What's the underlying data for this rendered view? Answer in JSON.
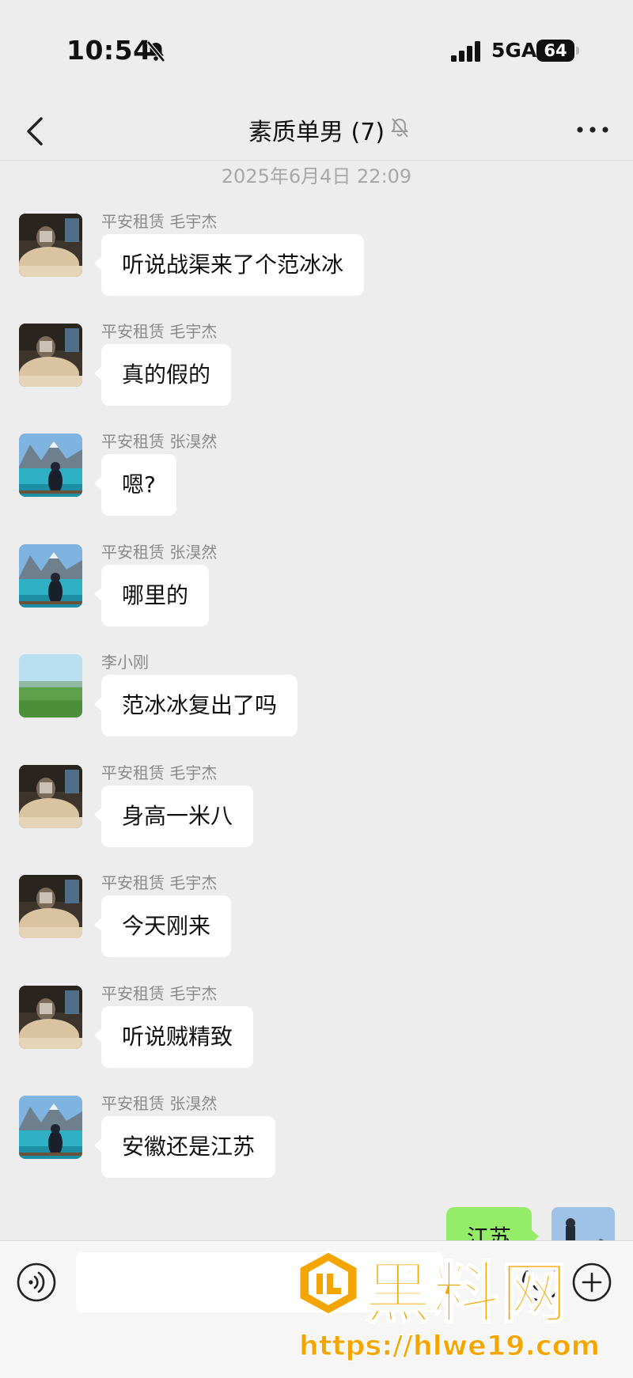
{
  "status_bar": {
    "time": "10:54",
    "network": "5GA",
    "battery": "64"
  },
  "header": {
    "title": "素质单男 (7)"
  },
  "chat": {
    "timestamp": "2025年6月4日 22:09",
    "messages": [
      {
        "sender": "平安租赁 毛宇杰",
        "text": "听说战渠来了个范冰冰"
      },
      {
        "sender": "平安租赁 毛宇杰",
        "text": "真的假的"
      },
      {
        "sender": "平安租赁 张湨然",
        "text": "嗯?"
      },
      {
        "sender": "平安租赁 张湨然",
        "text": "哪里的"
      },
      {
        "sender": "李小刚",
        "text": "范冰冰复出了吗"
      },
      {
        "sender": "平安租赁 毛宇杰",
        "text": "身高一米八"
      },
      {
        "sender": "平安租赁 毛宇杰",
        "text": "今天刚来"
      },
      {
        "sender": "平安租赁 毛宇杰",
        "text": "听说贼精致"
      },
      {
        "sender": "平安租赁 张湨然",
        "text": "安徽还是江苏"
      }
    ],
    "self_message": {
      "text": "江苏"
    }
  },
  "input": {
    "value": ""
  },
  "watermark": {
    "text": "黑料网",
    "url": "https://hlwe19.com"
  },
  "colors": {
    "background": "#ededed",
    "self_bubble": "#95ec69",
    "watermark": "#f5a500"
  }
}
